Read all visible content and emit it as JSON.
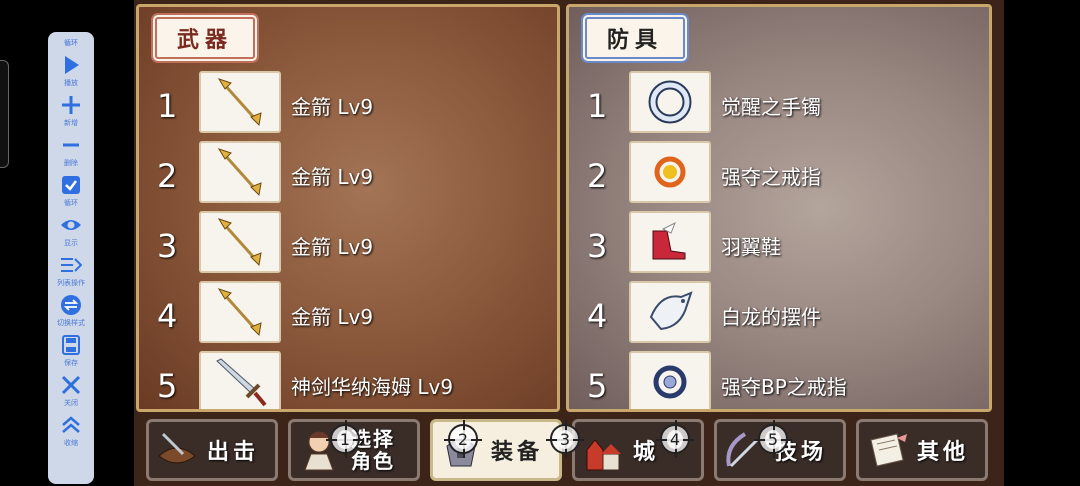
{
  "toolbar": {
    "top_label": "循环",
    "items": [
      {
        "label": "播放",
        "icon": "play-icon"
      },
      {
        "label": "新增",
        "icon": "plus-icon"
      },
      {
        "label": "删除",
        "icon": "minus-icon"
      },
      {
        "label": "循环",
        "icon": "checkbox-icon"
      },
      {
        "label": "显示",
        "icon": "eye-icon"
      },
      {
        "label": "列表操作",
        "icon": "list-icon"
      },
      {
        "label": "切换样式",
        "icon": "switch-icon"
      },
      {
        "label": "保存",
        "icon": "save-icon"
      },
      {
        "label": "关闭",
        "icon": "close-icon"
      },
      {
        "label": "收缩",
        "icon": "collapse-icon"
      }
    ]
  },
  "weapons": {
    "title": "武器",
    "items": [
      {
        "num": "1",
        "name": "金箭 Lv9",
        "icon": "golden-arrow-icon"
      },
      {
        "num": "2",
        "name": "金箭 Lv9",
        "icon": "golden-arrow-icon"
      },
      {
        "num": "3",
        "name": "金箭 Lv9",
        "icon": "golden-arrow-icon"
      },
      {
        "num": "4",
        "name": "金箭 Lv9",
        "icon": "golden-arrow-icon"
      },
      {
        "num": "5",
        "name": "神剑华纳海姆 Lv9",
        "icon": "sword-icon"
      }
    ]
  },
  "armor": {
    "title": "防具",
    "items": [
      {
        "num": "1",
        "name": "觉醒之手镯",
        "icon": "bracelet-icon"
      },
      {
        "num": "2",
        "name": "强夺之戒指",
        "icon": "ring-icon"
      },
      {
        "num": "3",
        "name": "羽翼鞋",
        "icon": "winged-shoes-icon"
      },
      {
        "num": "4",
        "name": "白龙的摆件",
        "icon": "white-dragon-icon"
      },
      {
        "num": "5",
        "name": "强夺BP之戒指",
        "icon": "bp-ring-icon"
      }
    ]
  },
  "menu": {
    "sortie": "出击",
    "select_char_line1": "选择",
    "select_char_line2": "角色",
    "equip": "装备",
    "castle": "城",
    "arena": "技场",
    "other": "其他"
  },
  "badges": [
    "1",
    "2",
    "3",
    "4",
    "5"
  ],
  "colors": {
    "weapon_panel": "#8c5a3c",
    "armor_panel": "#9a8882",
    "toolbar_accent": "#3a6fd8"
  }
}
